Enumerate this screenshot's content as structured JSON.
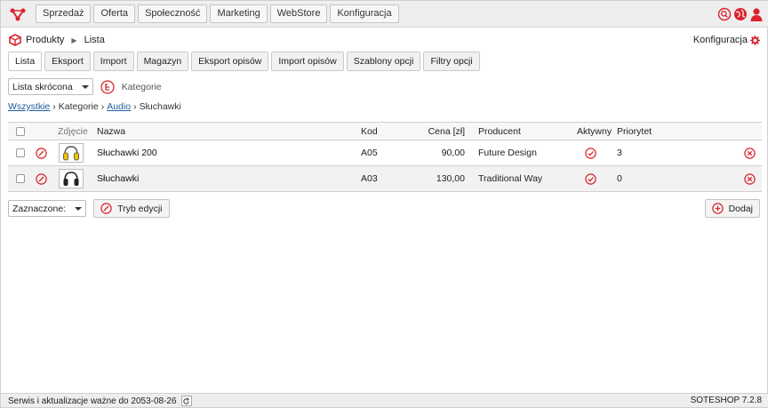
{
  "topnav": {
    "items": [
      "Sprzedaż",
      "Oferta",
      "Społeczność",
      "Marketing",
      "WebStore",
      "Konfiguracja"
    ]
  },
  "header": {
    "section": "Produkty",
    "subsection": "Lista",
    "config_label": "Konfiguracja"
  },
  "tabs": [
    "Lista",
    "Eksport",
    "Import",
    "Magazyn",
    "Eksport opisów",
    "Import opisów",
    "Szablony opcji",
    "Filtry opcji"
  ],
  "filter": {
    "view_select": "Lista skrócona",
    "categories_label": "Kategorie"
  },
  "breadcrumb": {
    "all": "Wszystkie",
    "categories": "Kategorie",
    "audio": "Audio",
    "current": "Słuchawki"
  },
  "table": {
    "columns": {
      "photo": "Zdjęcie",
      "name": "Nazwa",
      "code": "Kod",
      "price": "Cena [zł]",
      "producer": "Producent",
      "active": "Aktywny",
      "priority": "Priorytet"
    },
    "rows": [
      {
        "name": "Słuchawki 200",
        "code": "A05",
        "price": "90,00",
        "producer": "Future Design",
        "active": true,
        "priority": "3",
        "thumb_color": "#f2c200"
      },
      {
        "name": "Słuchawki",
        "code": "A03",
        "price": "130,00",
        "producer": "Traditional Way",
        "active": true,
        "priority": "0",
        "thumb_color": "#222222"
      }
    ]
  },
  "actions": {
    "selected_select": "Zaznaczone:",
    "edit_mode": "Tryb edycji",
    "add": "Dodaj"
  },
  "footer": {
    "service_text": "Serwis i aktualizacje ważne do 2053-08-26",
    "version": "SOTESHOP 7.2.8"
  },
  "colors": {
    "accent": "#d9232e",
    "link": "#1f5c9a"
  },
  "icons": [
    "logo-icon",
    "search-icon",
    "globe-icon",
    "user-icon",
    "box-icon",
    "gear-icon",
    "category-tree-icon",
    "edit-icon",
    "check-icon",
    "delete-icon",
    "add-icon",
    "refresh-icon"
  ]
}
